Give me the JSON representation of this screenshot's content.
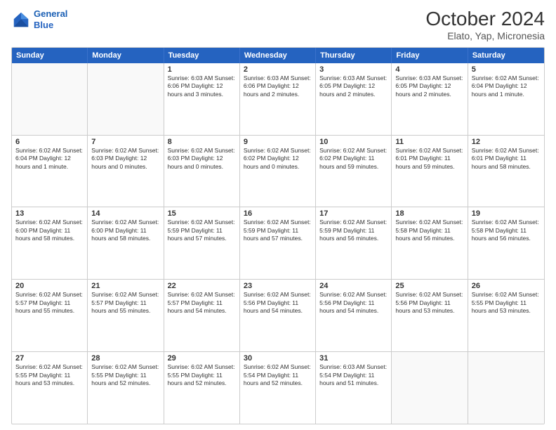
{
  "header": {
    "logo_line1": "General",
    "logo_line2": "Blue",
    "title": "October 2024",
    "subtitle": "Elato, Yap, Micronesia"
  },
  "weekdays": [
    "Sunday",
    "Monday",
    "Tuesday",
    "Wednesday",
    "Thursday",
    "Friday",
    "Saturday"
  ],
  "weeks": [
    [
      {
        "day": "",
        "info": "",
        "empty": true
      },
      {
        "day": "",
        "info": "",
        "empty": true
      },
      {
        "day": "1",
        "info": "Sunrise: 6:03 AM\nSunset: 6:06 PM\nDaylight: 12 hours\nand 3 minutes."
      },
      {
        "day": "2",
        "info": "Sunrise: 6:03 AM\nSunset: 6:06 PM\nDaylight: 12 hours\nand 2 minutes."
      },
      {
        "day": "3",
        "info": "Sunrise: 6:03 AM\nSunset: 6:05 PM\nDaylight: 12 hours\nand 2 minutes."
      },
      {
        "day": "4",
        "info": "Sunrise: 6:03 AM\nSunset: 6:05 PM\nDaylight: 12 hours\nand 2 minutes."
      },
      {
        "day": "5",
        "info": "Sunrise: 6:02 AM\nSunset: 6:04 PM\nDaylight: 12 hours\nand 1 minute."
      }
    ],
    [
      {
        "day": "6",
        "info": "Sunrise: 6:02 AM\nSunset: 6:04 PM\nDaylight: 12 hours\nand 1 minute."
      },
      {
        "day": "7",
        "info": "Sunrise: 6:02 AM\nSunset: 6:03 PM\nDaylight: 12 hours\nand 0 minutes."
      },
      {
        "day": "8",
        "info": "Sunrise: 6:02 AM\nSunset: 6:03 PM\nDaylight: 12 hours\nand 0 minutes."
      },
      {
        "day": "9",
        "info": "Sunrise: 6:02 AM\nSunset: 6:02 PM\nDaylight: 12 hours\nand 0 minutes."
      },
      {
        "day": "10",
        "info": "Sunrise: 6:02 AM\nSunset: 6:02 PM\nDaylight: 11 hours\nand 59 minutes."
      },
      {
        "day": "11",
        "info": "Sunrise: 6:02 AM\nSunset: 6:01 PM\nDaylight: 11 hours\nand 59 minutes."
      },
      {
        "day": "12",
        "info": "Sunrise: 6:02 AM\nSunset: 6:01 PM\nDaylight: 11 hours\nand 58 minutes."
      }
    ],
    [
      {
        "day": "13",
        "info": "Sunrise: 6:02 AM\nSunset: 6:00 PM\nDaylight: 11 hours\nand 58 minutes."
      },
      {
        "day": "14",
        "info": "Sunrise: 6:02 AM\nSunset: 6:00 PM\nDaylight: 11 hours\nand 58 minutes."
      },
      {
        "day": "15",
        "info": "Sunrise: 6:02 AM\nSunset: 5:59 PM\nDaylight: 11 hours\nand 57 minutes."
      },
      {
        "day": "16",
        "info": "Sunrise: 6:02 AM\nSunset: 5:59 PM\nDaylight: 11 hours\nand 57 minutes."
      },
      {
        "day": "17",
        "info": "Sunrise: 6:02 AM\nSunset: 5:59 PM\nDaylight: 11 hours\nand 56 minutes."
      },
      {
        "day": "18",
        "info": "Sunrise: 6:02 AM\nSunset: 5:58 PM\nDaylight: 11 hours\nand 56 minutes."
      },
      {
        "day": "19",
        "info": "Sunrise: 6:02 AM\nSunset: 5:58 PM\nDaylight: 11 hours\nand 56 minutes."
      }
    ],
    [
      {
        "day": "20",
        "info": "Sunrise: 6:02 AM\nSunset: 5:57 PM\nDaylight: 11 hours\nand 55 minutes."
      },
      {
        "day": "21",
        "info": "Sunrise: 6:02 AM\nSunset: 5:57 PM\nDaylight: 11 hours\nand 55 minutes."
      },
      {
        "day": "22",
        "info": "Sunrise: 6:02 AM\nSunset: 5:57 PM\nDaylight: 11 hours\nand 54 minutes."
      },
      {
        "day": "23",
        "info": "Sunrise: 6:02 AM\nSunset: 5:56 PM\nDaylight: 11 hours\nand 54 minutes."
      },
      {
        "day": "24",
        "info": "Sunrise: 6:02 AM\nSunset: 5:56 PM\nDaylight: 11 hours\nand 54 minutes."
      },
      {
        "day": "25",
        "info": "Sunrise: 6:02 AM\nSunset: 5:56 PM\nDaylight: 11 hours\nand 53 minutes."
      },
      {
        "day": "26",
        "info": "Sunrise: 6:02 AM\nSunset: 5:55 PM\nDaylight: 11 hours\nand 53 minutes."
      }
    ],
    [
      {
        "day": "27",
        "info": "Sunrise: 6:02 AM\nSunset: 5:55 PM\nDaylight: 11 hours\nand 53 minutes."
      },
      {
        "day": "28",
        "info": "Sunrise: 6:02 AM\nSunset: 5:55 PM\nDaylight: 11 hours\nand 52 minutes."
      },
      {
        "day": "29",
        "info": "Sunrise: 6:02 AM\nSunset: 5:55 PM\nDaylight: 11 hours\nand 52 minutes."
      },
      {
        "day": "30",
        "info": "Sunrise: 6:02 AM\nSunset: 5:54 PM\nDaylight: 11 hours\nand 52 minutes."
      },
      {
        "day": "31",
        "info": "Sunrise: 6:03 AM\nSunset: 5:54 PM\nDaylight: 11 hours\nand 51 minutes."
      },
      {
        "day": "",
        "info": "",
        "empty": true
      },
      {
        "day": "",
        "info": "",
        "empty": true
      }
    ]
  ]
}
